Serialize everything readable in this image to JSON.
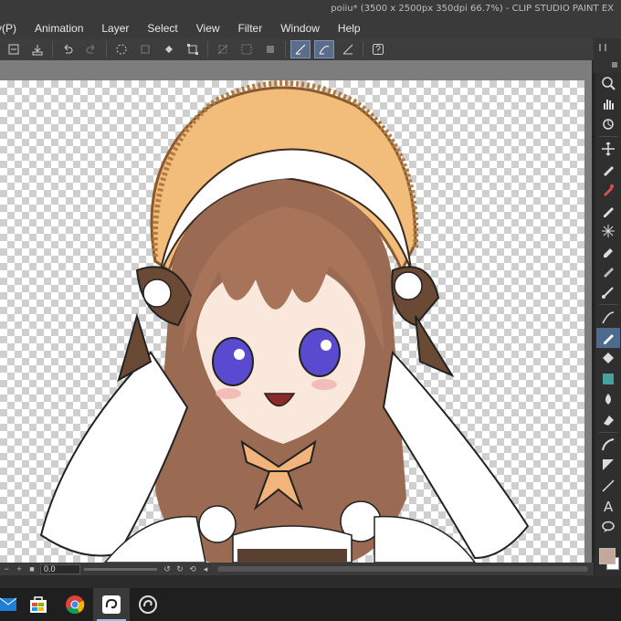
{
  "window": {
    "title": "poiiu* (3500 x 2500px 350dpi 66.7%) - CLIP STUDIO PAINT EX"
  },
  "menu": {
    "items": [
      "ry(P)",
      "Animation",
      "Layer",
      "Select",
      "View",
      "Filter",
      "Window",
      "Help"
    ]
  },
  "toolbar": {
    "buttons": [
      "new-file-icon",
      "save-icon",
      "undo-icon",
      "redo-icon",
      "loading-icon",
      "clear-icon",
      "fill-icon",
      "transform-icon",
      "hide-selection-icon",
      "select-all-icon",
      "deselect-icon",
      "snap-ruler-icon",
      "snap-special-ruler-icon",
      "snap-grid-icon",
      "help-icon"
    ]
  },
  "tools": {
    "items": [
      "zoom-icon",
      "hand-icon",
      "rotate-icon",
      "move-icon",
      "selection-icon",
      "eyedropper-icon",
      "pen-icon",
      "pencil-icon",
      "brush-icon",
      "airbrush-icon",
      "decoration-icon",
      "eraser-icon",
      "blend-icon",
      "fill-icon",
      "gradient-icon",
      "figure-icon",
      "frame-icon",
      "text-icon",
      "balloon-icon",
      "correct-line-icon",
      "ruler-icon"
    ],
    "selected_index": 12
  },
  "colors": {
    "main": "#c6a89a",
    "sub": "#ffffff",
    "canvas_bg": "#7d7d7d",
    "accent": "#4f6a8f"
  },
  "statusbar": {
    "rotation_value": "0.0"
  },
  "taskbar": {
    "apps": [
      "mail-icon",
      "store-icon",
      "chrome-icon",
      "clip-studio-icon",
      "clip-studio-paint-icon"
    ],
    "active_index": 3
  }
}
